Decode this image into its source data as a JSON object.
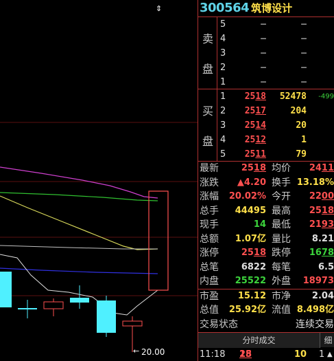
{
  "stock": {
    "code": "300564",
    "name": "筑博设计"
  },
  "chart_annotations": {
    "scroll_marker": "⇕",
    "low_price_label": "20.00",
    "low_price_arrow": "←"
  },
  "order_book": {
    "sell_label_1": "卖",
    "sell_label_2": "盘",
    "buy_label_1": "买",
    "buy_label_2": "盘",
    "sell": [
      {
        "level": "5",
        "price": "–",
        "volume": "–"
      },
      {
        "level": "4",
        "price": "–",
        "volume": "–"
      },
      {
        "level": "3",
        "price": "–",
        "volume": "–"
      },
      {
        "level": "2",
        "price": "–",
        "volume": "–"
      },
      {
        "level": "1",
        "price": "–",
        "volume": "–"
      }
    ],
    "buy": [
      {
        "level": "1",
        "price_main": "25",
        "price_tail": "18",
        "volume": "52478",
        "change": "-499"
      },
      {
        "level": "2",
        "price_main": "25",
        "price_tail": "17",
        "volume": "204",
        "change": ""
      },
      {
        "level": "3",
        "price_main": "25",
        "price_tail": "14",
        "volume": "20",
        "change": ""
      },
      {
        "level": "4",
        "price_main": "25",
        "price_tail": "12",
        "volume": "1",
        "change": ""
      },
      {
        "level": "5",
        "price_main": "25",
        "price_tail": "11",
        "volume": "79",
        "change": ""
      }
    ]
  },
  "quote": {
    "latest_label": "最新",
    "latest_main": "25",
    "latest_tail": "18",
    "avg_label": "均价",
    "avg_main": "24",
    "avg_tail": "11",
    "change_label": "涨跌",
    "change_value": "▲4.20",
    "turnover_label": "换手",
    "turnover_value": "13.18%",
    "pct_label": "涨幅",
    "pct_value": "20.02%",
    "open_label": "今开",
    "open_main": "22",
    "open_tail": "00",
    "hand_label": "总手",
    "hand_value": "44495",
    "high_label": "最高",
    "high_main": "25",
    "high_tail": "18",
    "now_label": "现手",
    "now_value": "14",
    "low_label": "最低",
    "low_main": "21",
    "low_tail": "93",
    "amount_label": "总额",
    "amount_value": "1.07亿",
    "ratio_label": "量比",
    "ratio_value": "8.21",
    "limit_up_label": "涨停",
    "limit_up_main": "25",
    "limit_up_tail": "18",
    "limit_down_label": "跌停",
    "limit_down_main": "16",
    "limit_down_tail": "78",
    "deals_label": "总笔",
    "deals_value": "6822",
    "per_deal_label": "每笔",
    "per_deal_value": "6.5",
    "inner_label": "内盘",
    "inner_value": "25522",
    "outer_label": "外盘",
    "outer_value": "18973",
    "pe_label": "市盈",
    "pe_value": "15.12",
    "pb_label": "市净",
    "pb_value": "2.04",
    "mcap_label": "总值",
    "mcap_value": "25.92亿",
    "float_label": "流值",
    "float_value": "8.498亿",
    "status_label": "交易状态",
    "status_value": "连续交易"
  },
  "tabs": {
    "main": "分时成交",
    "detail": "细"
  },
  "last_trade": {
    "time": "11:18",
    "price_main": "25",
    "price_tail": "18",
    "volume": "10",
    "count": "1",
    "arrow": "▲"
  }
}
